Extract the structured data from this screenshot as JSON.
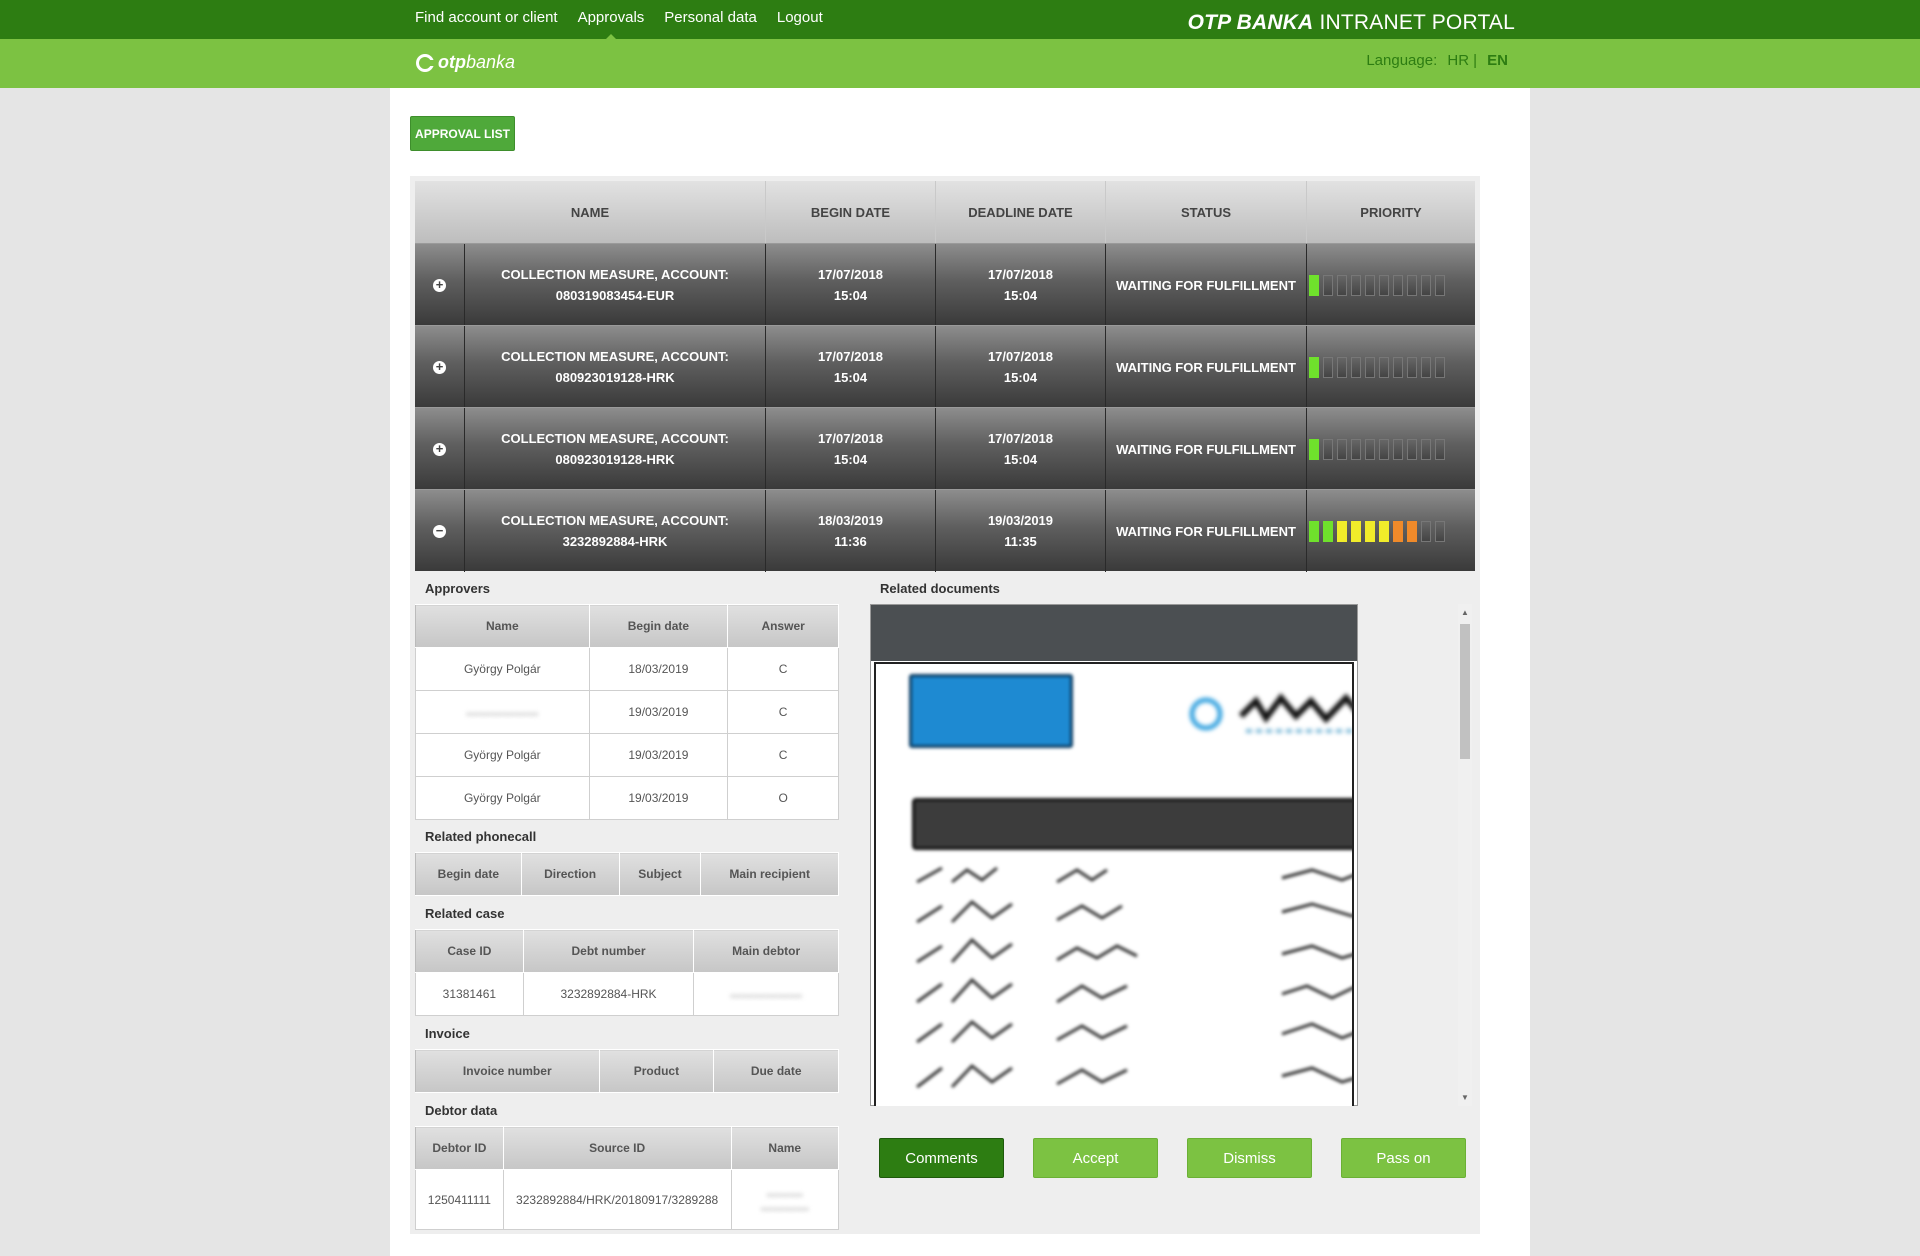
{
  "nav": {
    "items": [
      "Find account or client",
      "Approvals",
      "Personal data",
      "Logout"
    ],
    "active_index": 1,
    "portal_title_bold": "OTP BANKA",
    "portal_title_rest": " INTRANET PORTAL"
  },
  "brand": {
    "logo_bold": "otp",
    "logo_light": "banka",
    "language_label": "Language:",
    "lang_hr": "HR",
    "lang_sep": "|",
    "lang_en": "EN"
  },
  "approval_list_button": "APPROVAL LIST",
  "main_table": {
    "headers": [
      "NAME",
      "BEGIN DATE",
      "DEADLINE DATE",
      "STATUS",
      "PRIORITY"
    ],
    "rows": [
      {
        "toggle": "+",
        "name_line1": "COLLECTION MEASURE, ACCOUNT:",
        "name_line2": "080319083454-EUR",
        "begin_date": "17/07/2018",
        "begin_time": "15:04",
        "deadline_date": "17/07/2018",
        "deadline_time": "15:04",
        "status": "WAITING FOR FULFILLMENT",
        "priority": [
          "g",
          "n",
          "n",
          "n",
          "n",
          "n",
          "n",
          "n",
          "n",
          "n"
        ]
      },
      {
        "toggle": "+",
        "name_line1": "COLLECTION MEASURE, ACCOUNT:",
        "name_line2": "080923019128-HRK",
        "begin_date": "17/07/2018",
        "begin_time": "15:04",
        "deadline_date": "17/07/2018",
        "deadline_time": "15:04",
        "status": "WAITING FOR FULFILLMENT",
        "priority": [
          "g",
          "n",
          "n",
          "n",
          "n",
          "n",
          "n",
          "n",
          "n",
          "n"
        ]
      },
      {
        "toggle": "+",
        "name_line1": "COLLECTION MEASURE, ACCOUNT:",
        "name_line2": "080923019128-HRK",
        "begin_date": "17/07/2018",
        "begin_time": "15:04",
        "deadline_date": "17/07/2018",
        "deadline_time": "15:04",
        "status": "WAITING FOR FULFILLMENT",
        "priority": [
          "g",
          "n",
          "n",
          "n",
          "n",
          "n",
          "n",
          "n",
          "n",
          "n"
        ]
      },
      {
        "toggle": "−",
        "name_line1": "COLLECTION MEASURE, ACCOUNT:",
        "name_line2": "3232892884-HRK",
        "begin_date": "18/03/2019",
        "begin_time": "11:36",
        "deadline_date": "19/03/2019",
        "deadline_time": "11:35",
        "status": "WAITING FOR FULFILLMENT",
        "priority": [
          "g",
          "g",
          "y",
          "y",
          "y",
          "y",
          "o",
          "o",
          "n",
          "n"
        ]
      }
    ]
  },
  "approvers": {
    "title": "Approvers",
    "headers": [
      "Name",
      "Begin date",
      "Answer"
    ],
    "rows": [
      [
        "György Polgár",
        "18/03/2019",
        "C"
      ],
      [
        "",
        "19/03/2019",
        "C"
      ],
      [
        "György Polgár",
        "19/03/2019",
        "C"
      ],
      [
        "György Polgár",
        "19/03/2019",
        "O"
      ]
    ]
  },
  "related_phonecall": {
    "title": "Related phonecall",
    "headers": [
      "Begin date",
      "Direction",
      "Subject",
      "Main recipient"
    ]
  },
  "related_case": {
    "title": "Related case",
    "headers": [
      "Case ID",
      "Debt number",
      "Main debtor"
    ],
    "rows": [
      [
        "31381461",
        "3232892884-HRK",
        ""
      ]
    ]
  },
  "invoice": {
    "title": "Invoice",
    "headers": [
      "Invoice number",
      "Product",
      "Due date"
    ]
  },
  "debtor_data": {
    "title": "Debtor data",
    "headers": [
      "Debtor ID",
      "Source ID",
      "Name"
    ],
    "rows": [
      [
        "1250411111",
        "3232892884/HRK/20180917/3289288",
        ""
      ]
    ]
  },
  "related_documents": {
    "title": "Related documents"
  },
  "actions": [
    "Comments",
    "Accept",
    "Dismiss",
    "Pass on"
  ],
  "colors": {
    "topbar": "#2d7d12",
    "subbar": "#7cc242",
    "priority_green": "#6fe12c",
    "priority_yellow": "#f1ec2a",
    "priority_orange": "#f08a2a"
  }
}
